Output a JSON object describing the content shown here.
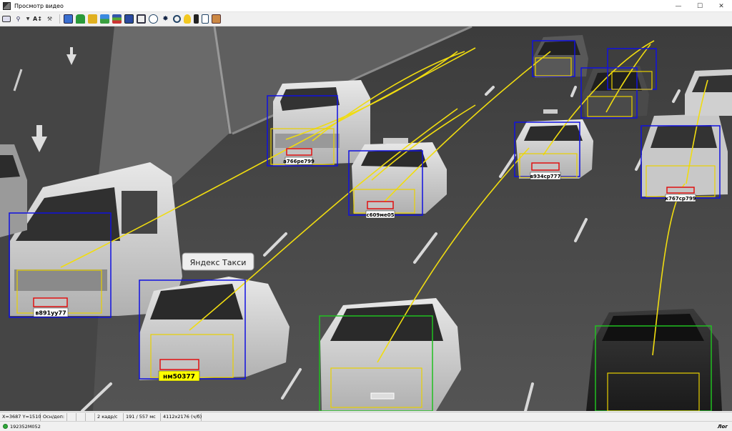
{
  "window": {
    "title": "Просмотр видео",
    "minimize": "—",
    "maximize": "☐",
    "close": "✕"
  },
  "toolbar": {
    "icons": [
      "video-view-icon",
      "zoom-icon",
      "dropdown-icon",
      "text-size-icon",
      "hammer-icon",
      "window-icon",
      "car-icon",
      "folder-icon",
      "image-icon",
      "layers-icon",
      "save-icon",
      "frame-icon",
      "clock-icon",
      "run-icon",
      "search-zoom-icon",
      "lightbulb-icon",
      "traffic-light-icon",
      "document-icon",
      "edit-icon"
    ]
  },
  "video": {
    "plates": [
      {
        "text": "а766ре799"
      },
      {
        "text": "с609ме05"
      },
      {
        "text": "в934ср777"
      },
      {
        "text": "к767ср799"
      },
      {
        "text": "в891уу77"
      },
      {
        "text": "нм50377"
      }
    ],
    "taxi_sign": "Яндекс Такси"
  },
  "statusbar": {
    "coords": "X=3687 Y=1510",
    "mode": "Осн/доп:",
    "framerate": "2 кадр/с",
    "timing": "191 / 557 мс",
    "resolution": "4112x2176 (ч/б)"
  },
  "bottombar": {
    "id": "192352М052",
    "log": "Лог"
  },
  "colors": {
    "detection_box": "#1010e0",
    "tracked_box": "#20c020",
    "track_line": "#f0dc10",
    "plate_box": "#e01010",
    "highlight_plate": "#ffff00"
  }
}
